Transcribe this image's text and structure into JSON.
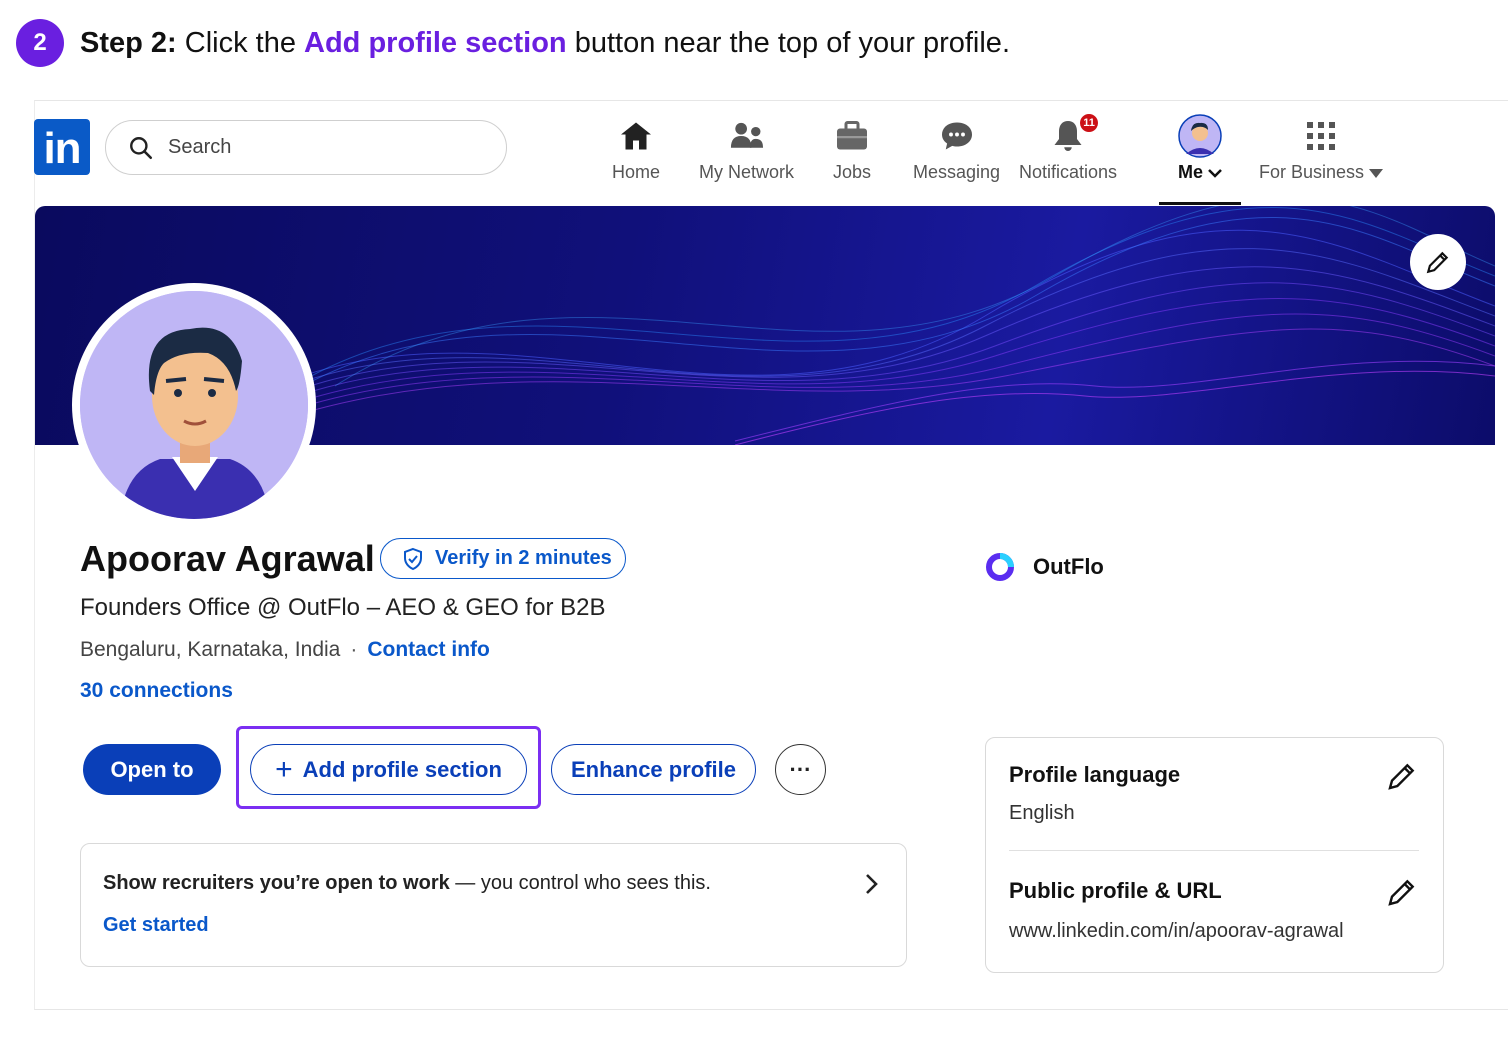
{
  "step": {
    "number": "2",
    "prefix": "Step 2:",
    "text_before": " Click the ",
    "highlight": "Add profile section",
    "text_after": " button near the top of your profile."
  },
  "nav": {
    "search_placeholder": "Search",
    "items": [
      {
        "label": "Home",
        "icon": "home-icon"
      },
      {
        "label": "My Network",
        "icon": "network-icon"
      },
      {
        "label": "Jobs",
        "icon": "briefcase-icon"
      },
      {
        "label": "Messaging",
        "icon": "message-icon"
      },
      {
        "label": "Notifications",
        "icon": "bell-icon",
        "badge": "11"
      },
      {
        "label": "Me",
        "icon": "avatar",
        "active": true
      },
      {
        "label": "For Business",
        "icon": "grid-icon"
      }
    ],
    "logo": "in"
  },
  "profile": {
    "name": "Apoorav Agrawal",
    "verify_label": "Verify in 2 minutes",
    "headline": "Founders Office @ OutFlo – AEO & GEO for B2B",
    "location": "Bengaluru, Karnataka, India",
    "separator": "·",
    "contact_info": "Contact info",
    "connections": "30 connections",
    "company": "OutFlo"
  },
  "actions": {
    "open_to": "Open to",
    "add_section_plus": "+",
    "add_section": "Add profile section",
    "enhance": "Enhance profile",
    "more": "···"
  },
  "open_to_work": {
    "strong": "Show recruiters you’re open to work",
    "rest": " — you control who sees this.",
    "cta": "Get started"
  },
  "side_card": {
    "language_title": "Profile language",
    "language_value": "English",
    "url_title": "Public profile & URL",
    "url_value": "www.linkedin.com/in/apoorav-agrawal"
  },
  "colors": {
    "accent_purple": "#6a1fe0",
    "linkedin_blue": "#0a58ca",
    "button_blue": "#0a3fb8",
    "notification_red": "#cc1016"
  }
}
